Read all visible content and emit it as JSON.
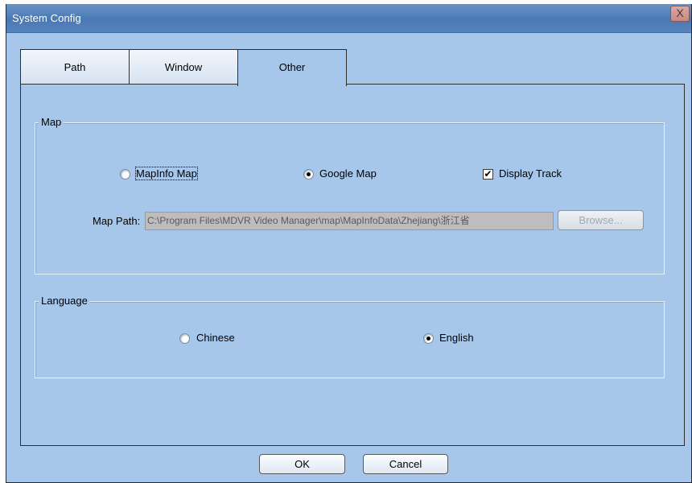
{
  "window": {
    "title": "System Config",
    "close_glyph": "X"
  },
  "tabs": [
    {
      "label": "Path",
      "active": false
    },
    {
      "label": "Window",
      "active": false
    },
    {
      "label": "Other",
      "active": true
    }
  ],
  "map_group": {
    "legend": "Map",
    "options": {
      "mapinfo": {
        "label": "MapInfo Map",
        "checked": false
      },
      "google": {
        "label": "Google Map",
        "checked": true
      },
      "display_track": {
        "label": "Display Track",
        "checked": true
      }
    },
    "path_label": "Map Path:",
    "path_value": "C:\\Program Files\\MDVR Video Manager\\map\\MapInfoData\\Zhejiang\\浙江省",
    "browse_label": "Browse..."
  },
  "language_group": {
    "legend": "Language",
    "options": {
      "chinese": {
        "label": "Chinese",
        "checked": false
      },
      "english": {
        "label": "English",
        "checked": true
      }
    }
  },
  "footer": {
    "ok_label": "OK",
    "cancel_label": "Cancel"
  }
}
